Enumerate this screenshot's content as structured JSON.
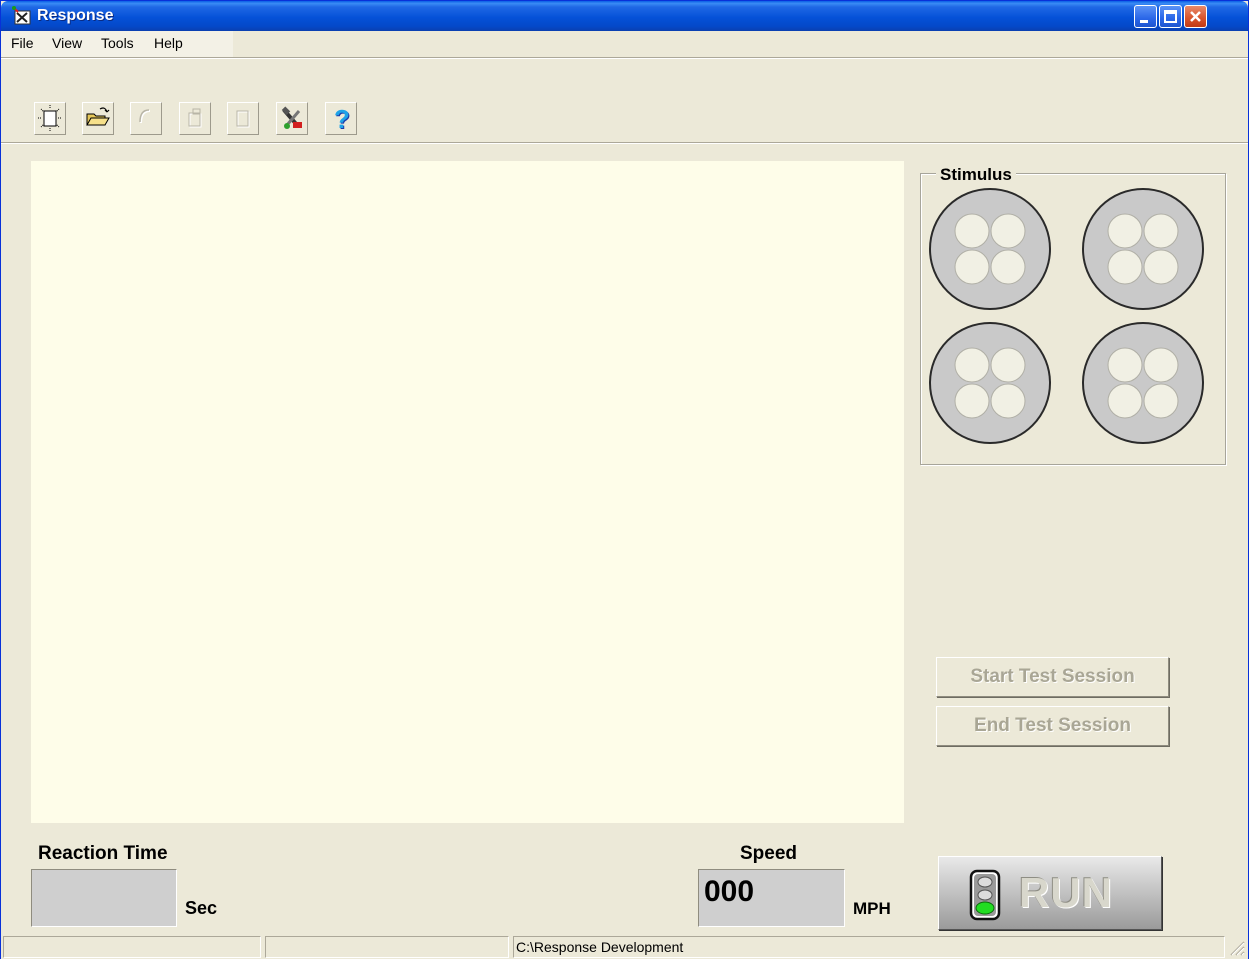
{
  "window": {
    "title": "Response",
    "controls": [
      "minimize-icon",
      "maximize-icon",
      "close-icon"
    ]
  },
  "menu": {
    "items": [
      "File",
      "View",
      "Tools",
      "Help"
    ]
  },
  "toolbar": {
    "buttons": [
      {
        "icon": "new-document-icon",
        "enabled": true
      },
      {
        "icon": "open-folder-icon",
        "enabled": true
      },
      {
        "icon": "undo-icon",
        "enabled": false
      },
      {
        "icon": "copy-icon",
        "enabled": false
      },
      {
        "icon": "paste-icon",
        "enabled": false
      },
      {
        "icon": "tools-icon",
        "enabled": true
      },
      {
        "icon": "help-icon",
        "enabled": true
      }
    ]
  },
  "stimulus": {
    "label": "Stimulus",
    "lamps": 4,
    "lamp_color": "#c9c9c9",
    "bulb_color": "#f1f0e4"
  },
  "buttons": {
    "start_session": "Start Test Session",
    "end_session": "End Test Session",
    "run": "RUN"
  },
  "reaction": {
    "label": "Reaction Time",
    "unit": "Sec",
    "value": ""
  },
  "speed": {
    "label": "Speed",
    "value": "000",
    "unit": "MPH"
  },
  "status": {
    "pane1": "",
    "pane2": "",
    "pane3": "C:\\Response Development"
  },
  "colors": {
    "display_bg": "#fefde9",
    "window_bg": "#ece9d8",
    "titlebar": "#0551d8"
  }
}
